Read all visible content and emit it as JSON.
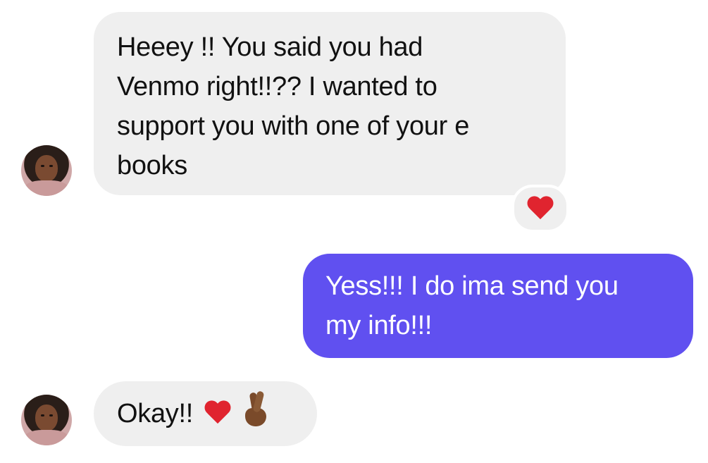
{
  "conversation": {
    "messages": [
      {
        "sender": "them",
        "text": "Heeey !! You said you had Venmo right!!?? I wanted to support you with one of your e books",
        "lines": [
          "Heeey !! You said you had",
          "Venmo right!!?? I wanted to",
          "support you with one of your e",
          "books"
        ],
        "reaction": "red-heart"
      },
      {
        "sender": "me",
        "text": "Yess!!! I do ima send you my info!!!",
        "lines": [
          "Yess!!! I do ima send you",
          "my info!!!"
        ]
      },
      {
        "sender": "them",
        "text": "Okay!!",
        "emojis": [
          "red-heart",
          "crossed-fingers"
        ]
      }
    ]
  },
  "colors": {
    "incoming_bubble": "#efefef",
    "outgoing_bubble": "#6050f0",
    "heart": "#e0242f"
  }
}
